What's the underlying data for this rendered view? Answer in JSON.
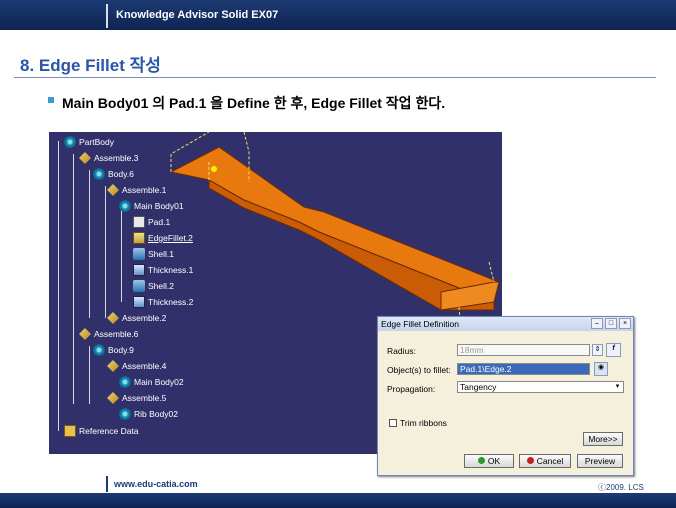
{
  "header": {
    "title": "Knowledge Advisor Solid EX07"
  },
  "slide": {
    "heading": "8. Edge Fillet 작성",
    "subtitle": "Main Body01 의 Pad.1 을 Define 한 후, Edge Fillet 작업 한다."
  },
  "tree": {
    "items": [
      {
        "label": "PartBody",
        "icon": "gear-icon"
      },
      {
        "label": "Assemble.3",
        "icon": "assemble-icon"
      },
      {
        "label": "Body.6",
        "icon": "gear-icon"
      },
      {
        "label": "Assemble.1",
        "icon": "assemble-icon"
      },
      {
        "label": "Main Body01",
        "icon": "gear-icon"
      },
      {
        "label": "Pad.1",
        "icon": "pad-icon"
      },
      {
        "label": "EdgeFillet.2",
        "icon": "edge-fillet-icon"
      },
      {
        "label": "Shell.1",
        "icon": "shell-icon"
      },
      {
        "label": "Thickness.1",
        "icon": "thickness-icon"
      },
      {
        "label": "Shell.2",
        "icon": "shell-icon"
      },
      {
        "label": "Thickness.2",
        "icon": "thickness-icon"
      },
      {
        "label": "Assemble.2",
        "icon": "assemble-icon"
      },
      {
        "label": "Assemble.6",
        "icon": "assemble-icon"
      },
      {
        "label": "Body.9",
        "icon": "gear-icon"
      },
      {
        "label": "Assemble.4",
        "icon": "assemble-icon"
      },
      {
        "label": "Main Body02",
        "icon": "gear-icon"
      },
      {
        "label": "Assemble.5",
        "icon": "assemble-icon"
      },
      {
        "label": "Rib Body02",
        "icon": "gear-icon"
      },
      {
        "label": "Reference Data",
        "icon": "reference-icon"
      }
    ]
  },
  "dialog": {
    "title": "Edge Fillet Definition",
    "radius_label": "Radius:",
    "radius_value": "18mm",
    "objects_label": "Object(s) to fillet:",
    "objects_value": "Pad.1\\Edge.2",
    "propagation_label": "Propagation:",
    "propagation_value": "Tangency",
    "trim_label": "Trim ribbons",
    "more_label": "More>>",
    "ok_label": "OK",
    "cancel_label": "Cancel",
    "preview_label": "Preview"
  },
  "footer": {
    "left": "www.edu-catia.com",
    "right": "ⓒ2009. LCS"
  },
  "colors": {
    "header": "#1c3a73",
    "heading": "#2b55a8",
    "viewport": "#32306a",
    "part": "#e0700a"
  }
}
